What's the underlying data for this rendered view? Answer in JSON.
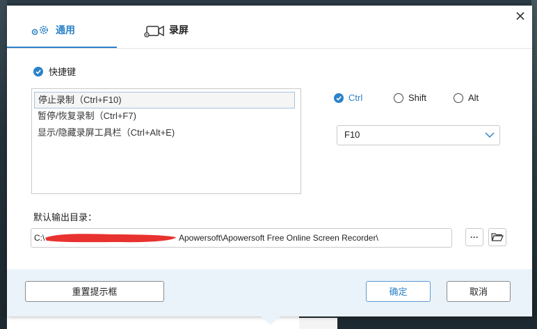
{
  "window": {
    "close_icon": "close-icon"
  },
  "tabs": [
    {
      "label": "通用",
      "icon": "gear-icon",
      "active": true
    },
    {
      "label": "录屏",
      "icon": "video-camera-icon",
      "active": false
    }
  ],
  "hotkeys": {
    "enabled_label": "快捷键",
    "enabled": true,
    "items": [
      {
        "label": "停止录制（Ctrl+F10)",
        "selected": true
      },
      {
        "label": "暂停/恢复录制（Ctrl+F7)",
        "selected": false
      },
      {
        "label": "显示/隐藏录屏工具栏（Ctrl+Alt+E)",
        "selected": false
      }
    ],
    "modifiers": [
      {
        "label": "Ctrl",
        "checked": true
      },
      {
        "label": "Shift",
        "checked": false
      },
      {
        "label": "Alt",
        "checked": false
      }
    ],
    "key_value": "F10"
  },
  "output": {
    "label": "默认输出目录：",
    "path_prefix": "C:\\",
    "path_suffix": "Apowersoft\\Apowersoft Free Online Screen Recorder\\",
    "browse_label": "···"
  },
  "footer": {
    "reset_label": "重置提示框",
    "ok_label": "确定",
    "cancel_label": "取消"
  },
  "colors": {
    "accent": "#2b82c9",
    "footer_bg": "#eaf3fa",
    "redaction": "#e8322f"
  }
}
